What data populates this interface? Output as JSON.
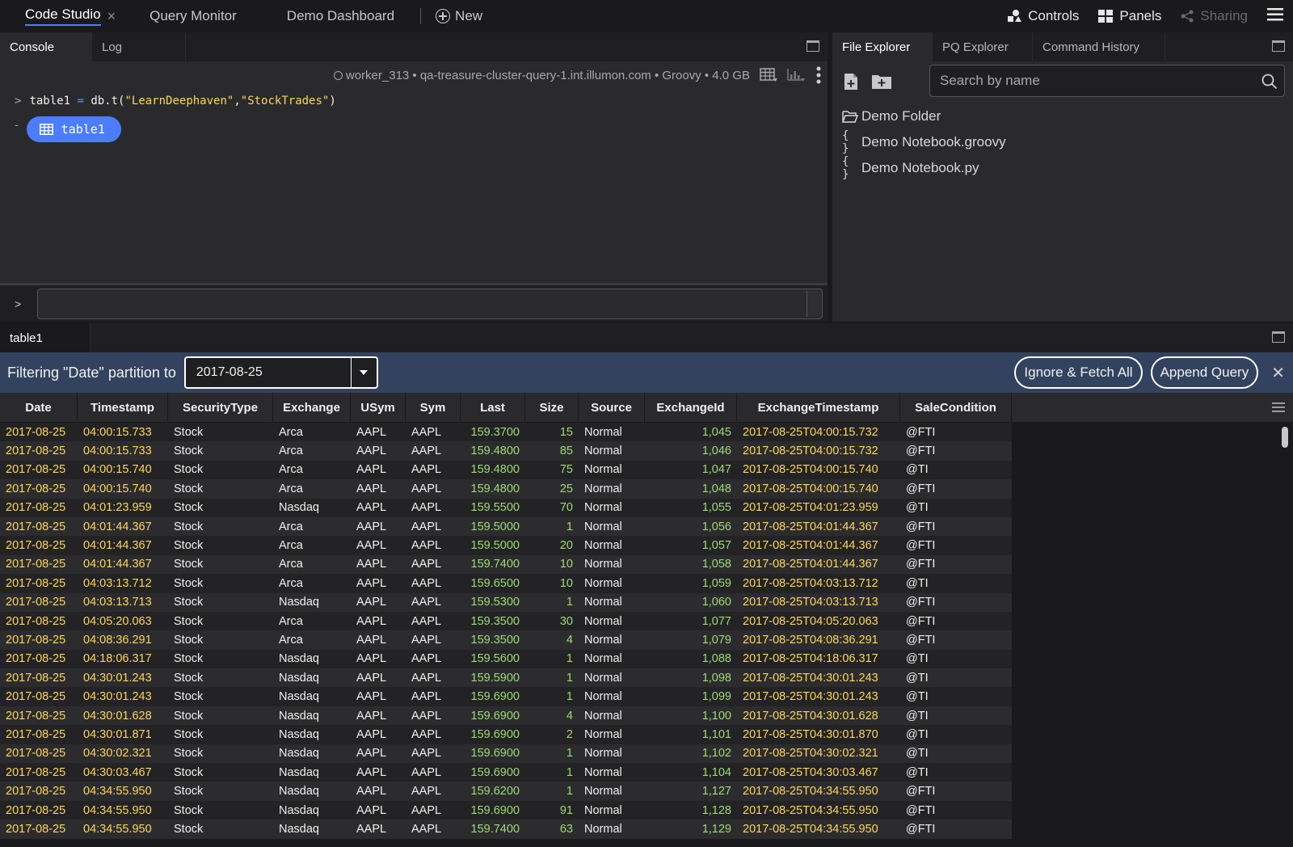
{
  "topbar": {
    "tabs": [
      {
        "label": "Code Studio"
      },
      {
        "label": "Query Monitor"
      },
      {
        "label": "Demo Dashboard"
      }
    ],
    "close_glyph": "×",
    "new_label": "New",
    "controls_label": "Controls",
    "panels_label": "Panels",
    "sharing_label": "Sharing",
    "menu_icon": "hamburger-icon"
  },
  "console": {
    "tabs": [
      "Console",
      "Log"
    ],
    "status": "worker_313 • qa-treasure-cluster-query-1.int.illumon.com • Groovy • 4.0 GB",
    "command": {
      "prompt": ">",
      "var": "table1",
      "eq": " = ",
      "obj": "db.t(",
      "arg1": "\"LearnDeephaven\"",
      "comma": ",",
      "arg2": "\"StockTrades\"",
      "close": ")"
    },
    "result_dash": "-",
    "result_label": "table1",
    "input_prompt": ">"
  },
  "file_explorer": {
    "tabs": [
      "File Explorer",
      "PQ Explorer",
      "Command History"
    ],
    "search_placeholder": "Search by name",
    "items": [
      {
        "icon": "folder-open-icon",
        "glyph": "",
        "label": "Demo Folder"
      },
      {
        "icon": "braces-icon",
        "glyph": "{ }",
        "label": "Demo Notebook.groovy"
      },
      {
        "icon": "braces-icon",
        "glyph": "{ }",
        "label": "Demo Notebook.py"
      }
    ]
  },
  "table_panel": {
    "tab": "table1",
    "filter_label": "Filtering \"Date\" partition to",
    "filter_value": "2017-08-25",
    "ignore_label": "Ignore & Fetch All",
    "append_label": "Append Query",
    "close_glyph": "✕",
    "columns": [
      "Date",
      "Timestamp",
      "SecurityType",
      "Exchange",
      "USym",
      "Sym",
      "Last",
      "Size",
      "Source",
      "ExchangeId",
      "ExchangeTimestamp",
      "SaleCondition"
    ],
    "rows": [
      [
        "2017-08-25",
        "04:00:15.733",
        "Stock",
        "Arca",
        "AAPL",
        "AAPL",
        "159.3700",
        "15",
        "Normal",
        "1,045",
        "2017-08-25T04:00:15.732",
        "@FTI"
      ],
      [
        "2017-08-25",
        "04:00:15.733",
        "Stock",
        "Arca",
        "AAPL",
        "AAPL",
        "159.4800",
        "85",
        "Normal",
        "1,046",
        "2017-08-25T04:00:15.732",
        "@FTI"
      ],
      [
        "2017-08-25",
        "04:00:15.740",
        "Stock",
        "Arca",
        "AAPL",
        "AAPL",
        "159.4800",
        "75",
        "Normal",
        "1,047",
        "2017-08-25T04:00:15.740",
        "@TI"
      ],
      [
        "2017-08-25",
        "04:00:15.740",
        "Stock",
        "Arca",
        "AAPL",
        "AAPL",
        "159.4800",
        "25",
        "Normal",
        "1,048",
        "2017-08-25T04:00:15.740",
        "@FTI"
      ],
      [
        "2017-08-25",
        "04:01:23.959",
        "Stock",
        "Nasdaq",
        "AAPL",
        "AAPL",
        "159.5500",
        "70",
        "Normal",
        "1,055",
        "2017-08-25T04:01:23.959",
        "@TI"
      ],
      [
        "2017-08-25",
        "04:01:44.367",
        "Stock",
        "Arca",
        "AAPL",
        "AAPL",
        "159.5000",
        "1",
        "Normal",
        "1,056",
        "2017-08-25T04:01:44.367",
        "@FTI"
      ],
      [
        "2017-08-25",
        "04:01:44.367",
        "Stock",
        "Arca",
        "AAPL",
        "AAPL",
        "159.5000",
        "20",
        "Normal",
        "1,057",
        "2017-08-25T04:01:44.367",
        "@FTI"
      ],
      [
        "2017-08-25",
        "04:01:44.367",
        "Stock",
        "Arca",
        "AAPL",
        "AAPL",
        "159.7400",
        "10",
        "Normal",
        "1,058",
        "2017-08-25T04:01:44.367",
        "@FTI"
      ],
      [
        "2017-08-25",
        "04:03:13.712",
        "Stock",
        "Arca",
        "AAPL",
        "AAPL",
        "159.6500",
        "10",
        "Normal",
        "1,059",
        "2017-08-25T04:03:13.712",
        "@TI"
      ],
      [
        "2017-08-25",
        "04:03:13.713",
        "Stock",
        "Nasdaq",
        "AAPL",
        "AAPL",
        "159.5300",
        "1",
        "Normal",
        "1,060",
        "2017-08-25T04:03:13.713",
        "@FTI"
      ],
      [
        "2017-08-25",
        "04:05:20.063",
        "Stock",
        "Arca",
        "AAPL",
        "AAPL",
        "159.3500",
        "30",
        "Normal",
        "1,077",
        "2017-08-25T04:05:20.063",
        "@FTI"
      ],
      [
        "2017-08-25",
        "04:08:36.291",
        "Stock",
        "Arca",
        "AAPL",
        "AAPL",
        "159.3500",
        "4",
        "Normal",
        "1,079",
        "2017-08-25T04:08:36.291",
        "@FTI"
      ],
      [
        "2017-08-25",
        "04:18:06.317",
        "Stock",
        "Nasdaq",
        "AAPL",
        "AAPL",
        "159.5600",
        "1",
        "Normal",
        "1,088",
        "2017-08-25T04:18:06.317",
        "@TI"
      ],
      [
        "2017-08-25",
        "04:30:01.243",
        "Stock",
        "Nasdaq",
        "AAPL",
        "AAPL",
        "159.5900",
        "1",
        "Normal",
        "1,098",
        "2017-08-25T04:30:01.243",
        "@TI"
      ],
      [
        "2017-08-25",
        "04:30:01.243",
        "Stock",
        "Nasdaq",
        "AAPL",
        "AAPL",
        "159.6900",
        "1",
        "Normal",
        "1,099",
        "2017-08-25T04:30:01.243",
        "@TI"
      ],
      [
        "2017-08-25",
        "04:30:01.628",
        "Stock",
        "Nasdaq",
        "AAPL",
        "AAPL",
        "159.6900",
        "4",
        "Normal",
        "1,100",
        "2017-08-25T04:30:01.628",
        "@TI"
      ],
      [
        "2017-08-25",
        "04:30:01.871",
        "Stock",
        "Nasdaq",
        "AAPL",
        "AAPL",
        "159.6900",
        "2",
        "Normal",
        "1,101",
        "2017-08-25T04:30:01.870",
        "@TI"
      ],
      [
        "2017-08-25",
        "04:30:02.321",
        "Stock",
        "Nasdaq",
        "AAPL",
        "AAPL",
        "159.6900",
        "1",
        "Normal",
        "1,102",
        "2017-08-25T04:30:02.321",
        "@TI"
      ],
      [
        "2017-08-25",
        "04:30:03.467",
        "Stock",
        "Nasdaq",
        "AAPL",
        "AAPL",
        "159.6900",
        "1",
        "Normal",
        "1,104",
        "2017-08-25T04:30:03.467",
        "@TI"
      ],
      [
        "2017-08-25",
        "04:34:55.950",
        "Stock",
        "Nasdaq",
        "AAPL",
        "AAPL",
        "159.6200",
        "1",
        "Normal",
        "1,127",
        "2017-08-25T04:34:55.950",
        "@FTI"
      ],
      [
        "2017-08-25",
        "04:34:55.950",
        "Stock",
        "Nasdaq",
        "AAPL",
        "AAPL",
        "159.6900",
        "91",
        "Normal",
        "1,128",
        "2017-08-25T04:34:55.950",
        "@FTI"
      ],
      [
        "2017-08-25",
        "04:34:55.950",
        "Stock",
        "Nasdaq",
        "AAPL",
        "AAPL",
        "159.7400",
        "63",
        "Normal",
        "1,129",
        "2017-08-25T04:34:55.950",
        "@FTI"
      ]
    ]
  },
  "colors": {
    "accent": "#4c7dfe",
    "date_text": "#fcd65b",
    "number_text": "#9edb74",
    "filter_bar": "#33435f"
  }
}
